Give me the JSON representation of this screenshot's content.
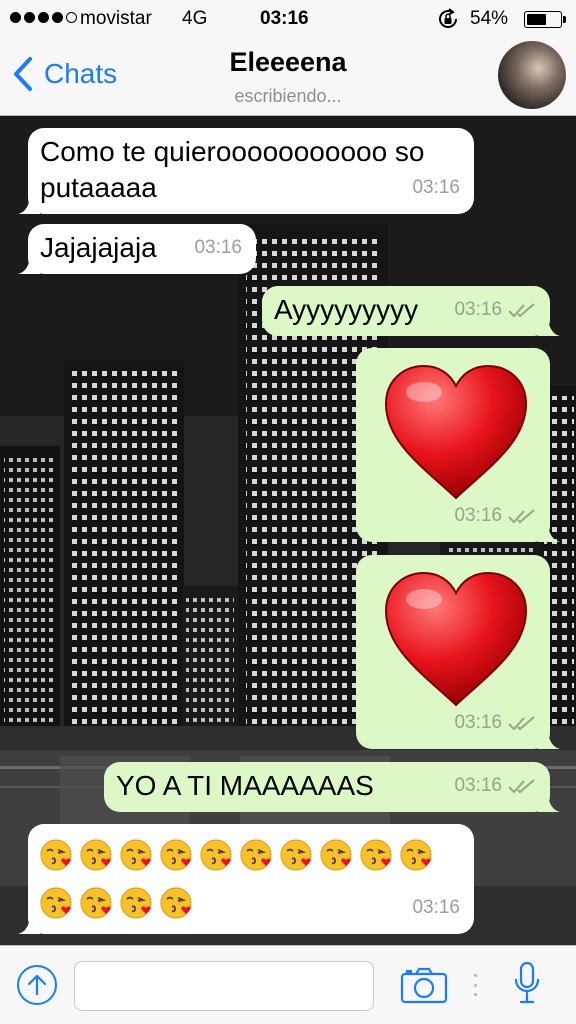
{
  "status_bar": {
    "carrier": "movistar",
    "network": "4G",
    "time": "03:16",
    "battery_percent": "54%",
    "battery_level": 0.54,
    "icons": [
      "signal-dots-icon",
      "rotation-lock-icon",
      "battery-icon"
    ]
  },
  "nav": {
    "back_label": "Chats",
    "contact_name": "Eleeeena",
    "contact_status": "escribiendo...",
    "icons": [
      "chevron-left-icon",
      "avatar"
    ]
  },
  "messages": [
    {
      "direction": "in",
      "type": "text",
      "line1": "Como te quierooooooooooo so",
      "line2": "putaaaaa",
      "time": "03:16"
    },
    {
      "direction": "in",
      "type": "text",
      "text": "Jajajajaja",
      "time": "03:16"
    },
    {
      "direction": "out",
      "type": "text",
      "text": "Ayyyyyyyyy",
      "time": "03:16",
      "status": "double-check-icon"
    },
    {
      "direction": "out",
      "type": "emoji",
      "emoji": "red-heart-icon",
      "time": "03:16",
      "status": "double-check-icon"
    },
    {
      "direction": "out",
      "type": "emoji",
      "emoji": "red-heart-icon",
      "time": "03:16",
      "status": "double-check-icon"
    },
    {
      "direction": "out",
      "type": "text",
      "text": "YO A TI MAAAAAAS",
      "time": "03:16",
      "status": "double-check-icon"
    },
    {
      "direction": "in",
      "type": "emoji",
      "emoji": "kissing-face-icon",
      "count": 14,
      "time": "03:16"
    }
  ],
  "input_bar": {
    "message_placeholder": "",
    "icons": [
      "upload-icon",
      "camera-icon",
      "microphone-icon"
    ]
  },
  "colors": {
    "accent": "#1a7cf6",
    "incoming_bubble": "#ffffff",
    "outgoing_bubble": "#dcf8c6",
    "bar_background": "#f7f7f7"
  }
}
